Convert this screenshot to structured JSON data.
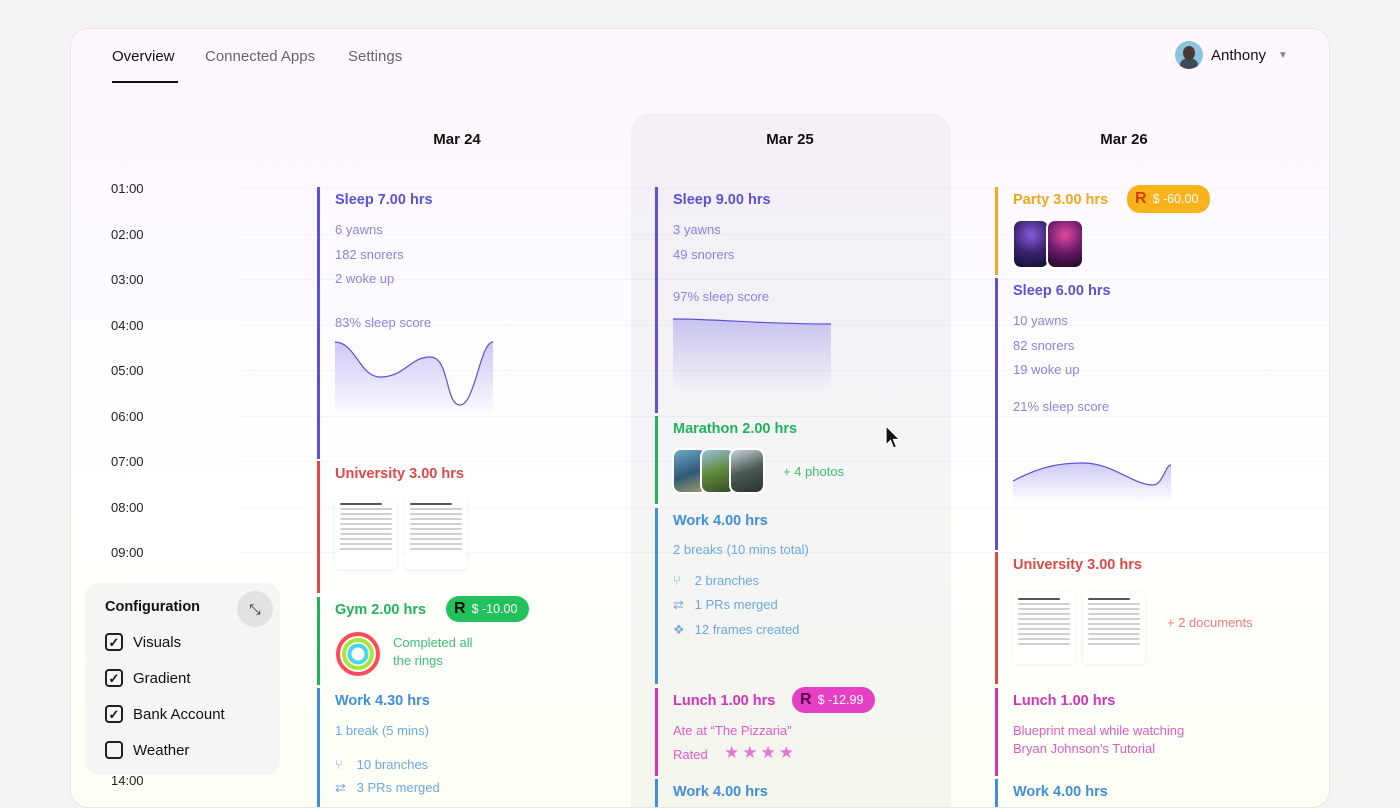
{
  "nav": {
    "tabs": [
      "Overview",
      "Connected Apps",
      "Settings"
    ],
    "user": "Anthony"
  },
  "dates": [
    "Mar 24",
    "Mar 25",
    "Mar 26"
  ],
  "hours": [
    "01:00",
    "02:00",
    "03:00",
    "04:00",
    "05:00",
    "06:00",
    "07:00",
    "08:00",
    "09:00",
    "14:00"
  ],
  "col1": {
    "sleep": {
      "title": "Sleep 7.00 hrs",
      "lines": [
        "6 yawns",
        "182 snorers",
        "2 woke up"
      ],
      "score": "83% sleep score"
    },
    "university": {
      "title": "University 3.00 hrs"
    },
    "gym": {
      "title": "Gym 2.00 hrs",
      "amount": "$ -10.00",
      "note1": "Completed all",
      "note2": "the rings"
    },
    "work": {
      "title": "Work 4.30 hrs",
      "line": "1 break (5 mins)",
      "branches": "10 branches",
      "merged": "3 PRs merged"
    }
  },
  "col2": {
    "sleep": {
      "title": "Sleep 9.00 hrs",
      "lines": [
        "3 yawns",
        "49 snorers"
      ],
      "score": "97% sleep score"
    },
    "marathon": {
      "title": "Marathon 2.00 hrs",
      "photos": "+ 4 photos"
    },
    "work": {
      "title": "Work 4.00 hrs",
      "line": "2 breaks (10 mins total)",
      "branches": "2 branches",
      "merged": "1 PRs merged",
      "frames": "12 frames created"
    },
    "lunch": {
      "title": "Lunch 1.00 hrs",
      "amount": "$ -12.99",
      "line1": "Ate at “The Pizzaria”",
      "rated": "Rated",
      "stars": "★★★★"
    },
    "next": {
      "title": "Work 4.00 hrs"
    }
  },
  "col3": {
    "party": {
      "title": "Party 3.00 hrs",
      "amount": "$ -60.00"
    },
    "sleep": {
      "title": "Sleep 6.00 hrs",
      "lines": [
        "10 yawns",
        "82 snorers",
        "19 woke up"
      ],
      "score": "21% sleep score"
    },
    "university": {
      "title": "University 3.00 hrs",
      "docs": "+ 2 documents"
    },
    "lunch": {
      "title": "Lunch 1.00 hrs",
      "line1": "Blueprint meal while watching",
      "line2": "Bryan Johnson’s Tutorial"
    },
    "next": {
      "title": "Work 4.00 hrs"
    }
  },
  "config": {
    "title": "Configuration",
    "options": [
      {
        "label": "Visuals",
        "checked": true
      },
      {
        "label": "Gradient",
        "checked": true
      },
      {
        "label": "Bank Account",
        "checked": true
      },
      {
        "label": "Weather",
        "checked": false
      }
    ]
  },
  "colors": {
    "sleep": "#5b52d6",
    "university": "#e04848",
    "gym": "#22b35a",
    "work": "#3f8fdc",
    "lunch": "#d434b8",
    "party": "#f0a81c"
  },
  "icons": [
    "chevron-down-icon",
    "dollar-badge-icon",
    "branch-icon",
    "merge-icon",
    "figma-icon",
    "star-icon",
    "collapse-icon",
    "checkbox-icon",
    "cursor-icon"
  ]
}
